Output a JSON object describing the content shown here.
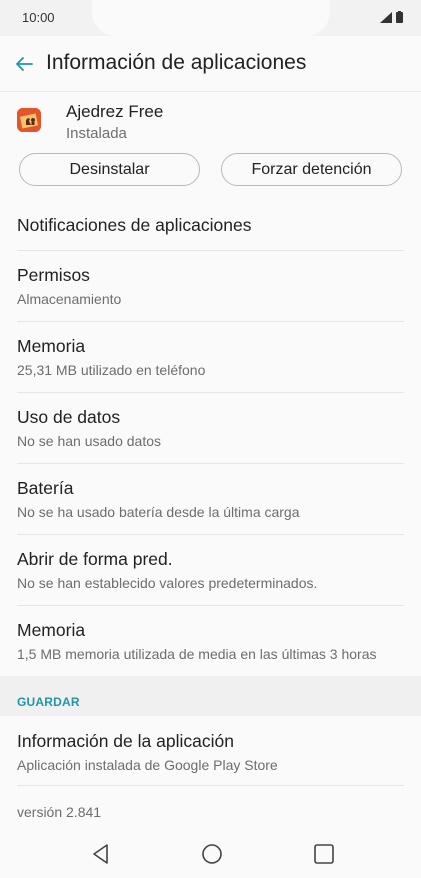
{
  "status_bar": {
    "time": "10:00"
  },
  "header": {
    "title": "Información de aplicaciones"
  },
  "app": {
    "name": "Ajedrez Free",
    "status": "Instalada"
  },
  "buttons": {
    "uninstall": "Desinstalar",
    "force_stop": "Forzar detención"
  },
  "rows": [
    {
      "title": "Notificaciones de aplicaciones",
      "subtitle": ""
    },
    {
      "title": "Permisos",
      "subtitle": "Almacenamiento"
    },
    {
      "title": "Memoria",
      "subtitle": "25,31 MB utilizado en teléfono"
    },
    {
      "title": "Uso de datos",
      "subtitle": "No se han usado datos"
    },
    {
      "title": "Batería",
      "subtitle": "No se ha usado batería desde la última carga"
    },
    {
      "title": "Abrir de forma pred.",
      "subtitle": "No se han establecido valores predeterminados."
    },
    {
      "title": "Memoria",
      "subtitle": "1,5 MB memoria utilizada de media en las últimas 3 horas"
    }
  ],
  "section": {
    "label": "GUARDAR"
  },
  "app_info": {
    "title": "Información de la aplicación",
    "subtitle": "Aplicación instalada de Google Play Store"
  },
  "version": "versión 2.841",
  "colors": {
    "accent": "#2196a8",
    "icon_bg": "#e6542a"
  },
  "icons": [
    "back-arrow-icon",
    "signal-icon",
    "battery-icon",
    "chess-app-icon",
    "nav-back-icon",
    "nav-home-icon",
    "nav-recents-icon"
  ]
}
